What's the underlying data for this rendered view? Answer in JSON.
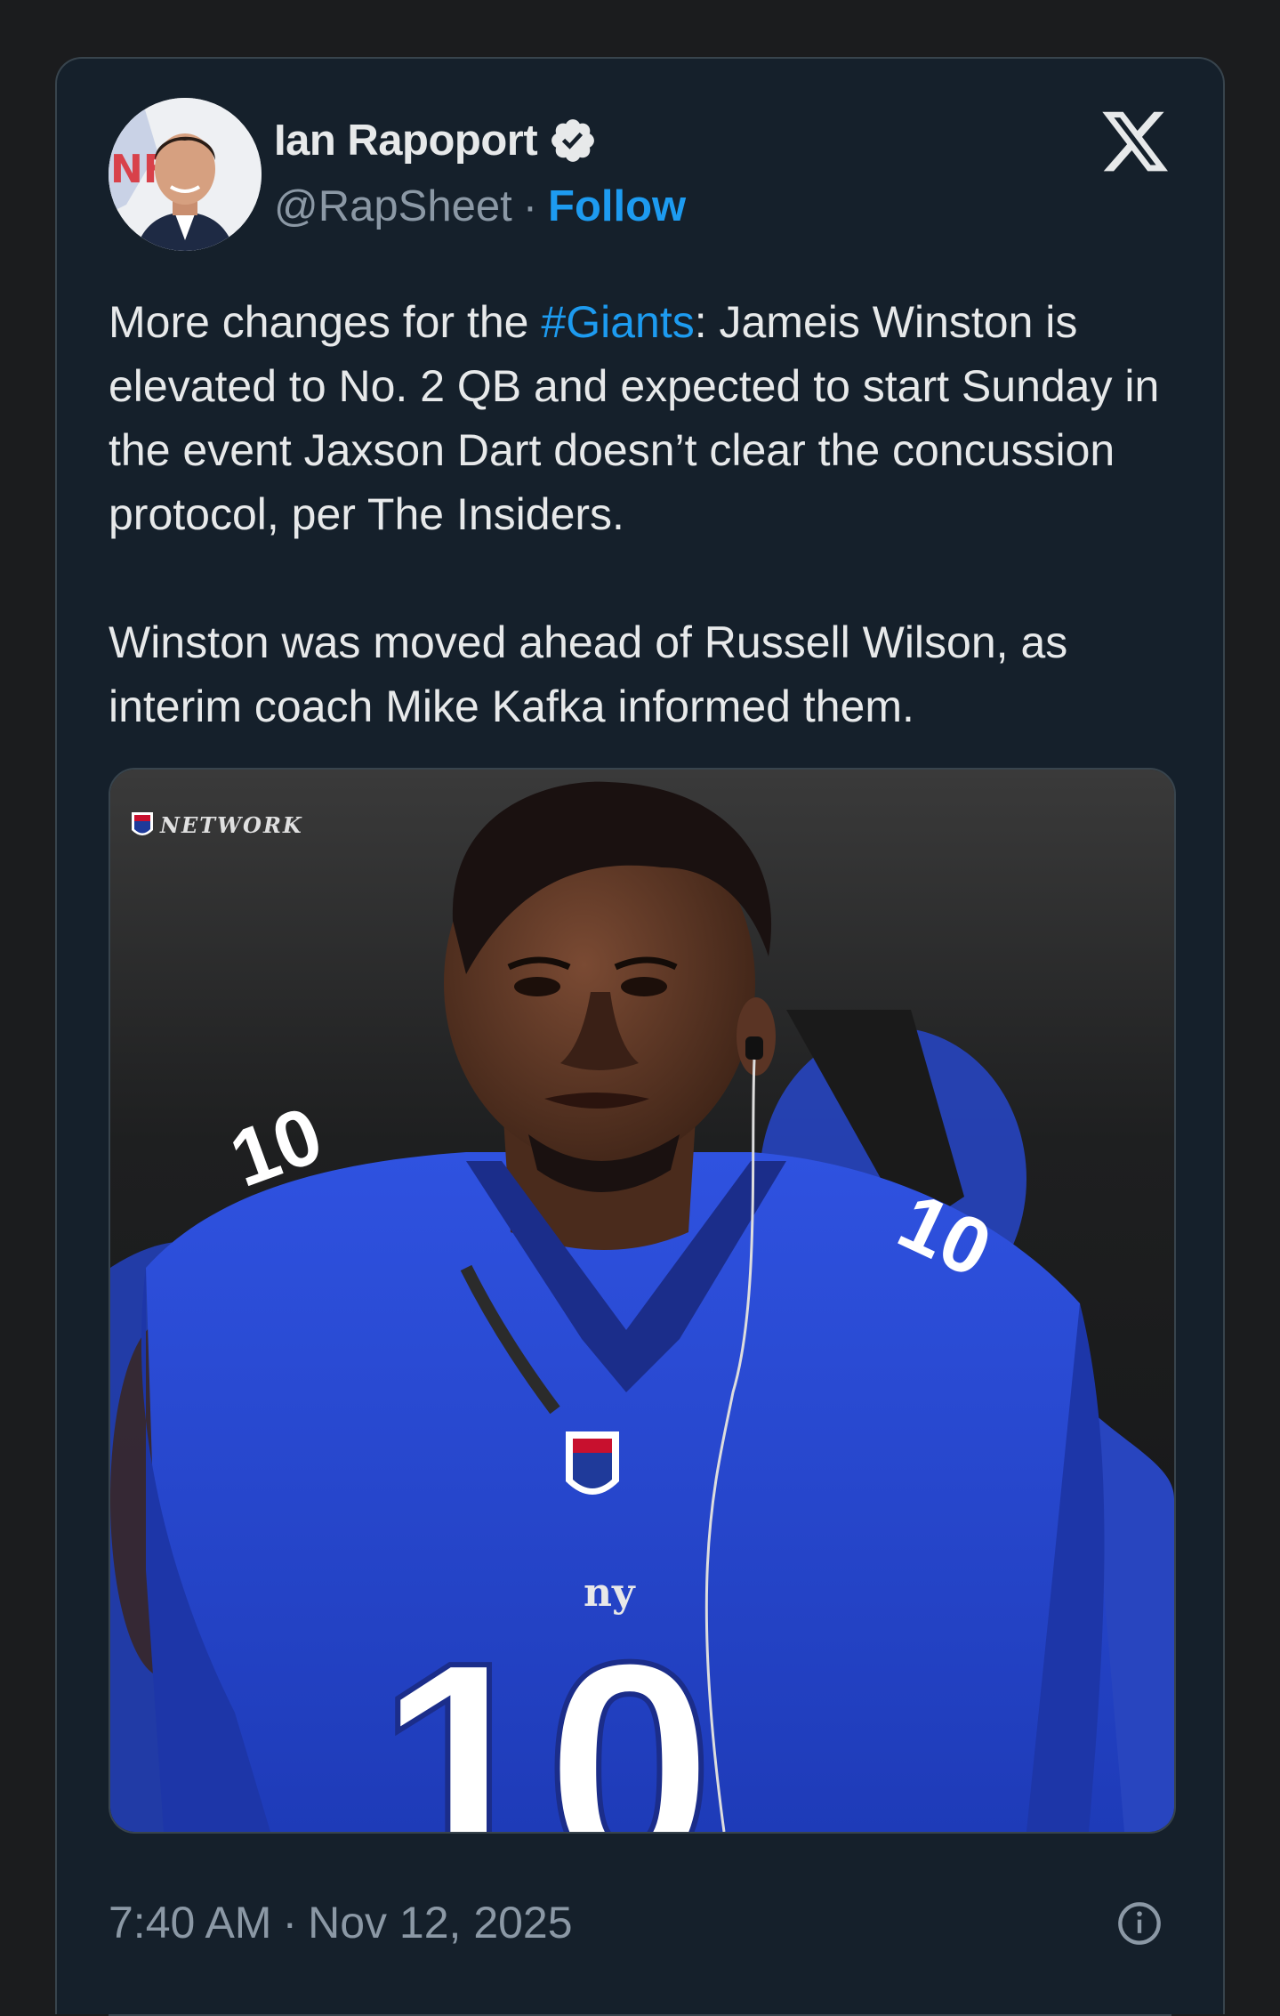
{
  "author": {
    "name": "Ian Rapoport",
    "handle": "@RapSheet",
    "separator": "·",
    "follow_label": "Follow",
    "verified_icon": "verified-badge-icon"
  },
  "brand": {
    "icon": "x-logo-icon"
  },
  "tweet": {
    "p1_before": "More changes for the ",
    "hashtag": "#Giants",
    "p1_after": ": Jameis Winston is elevated to No. 2 QB and expected to start Sunday in the event Jaxson Dart doesn’t clear the concussion protocol, per The Insiders.",
    "p2": "Winston was moved ahead of Russell Wilson, as interim coach Mike Kafka informed them."
  },
  "media": {
    "watermark_text": "NETWORK",
    "jersey_number": "10"
  },
  "footer": {
    "time": "7:40 AM",
    "separator": "·",
    "date": "Nov 12, 2025",
    "info_icon": "info-circle-icon"
  },
  "colors": {
    "background": "#15202b",
    "text": "#e7e9ea",
    "muted": "#8b98a5",
    "accent": "#1d9bf0",
    "jersey": "#2a4bd7"
  }
}
